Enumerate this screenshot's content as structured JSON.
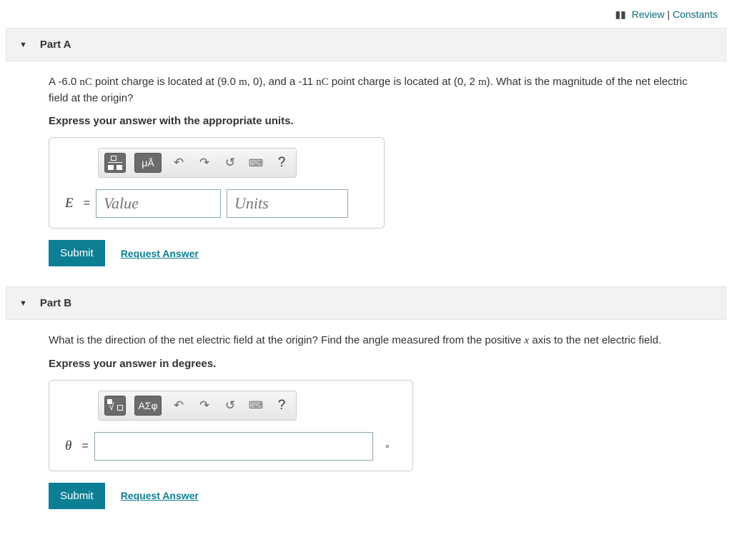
{
  "topnav": {
    "review": "Review",
    "constants": "Constants",
    "separator": " | "
  },
  "partA": {
    "title": "Part A",
    "question_html": "A -6.0 <span class='rm'>nC</span> point charge is located at (9.0 <span class='rm'>m</span>, 0), and a -11 <span class='rm'>nC</span> point charge is located at (0, 2 <span class='rm'>m</span>). What is the magnitude of the net electric field at the origin?",
    "instruction": "Express your answer with the appropriate units.",
    "toolbar": {
      "units_btn": "μÅ",
      "help": "?"
    },
    "var_label": "E",
    "value_placeholder": "Value",
    "units_placeholder": "Units",
    "submit": "Submit",
    "request": "Request Answer"
  },
  "partB": {
    "title": "Part B",
    "question_html": "What is the direction of the net electric field at the origin? Find the angle measured from the positive <span class='math-var'>x</span> axis to the net electric field.",
    "instruction": "Express your answer in degrees.",
    "toolbar": {
      "greek_btn": "ΑΣφ",
      "help": "?"
    },
    "var_label": "θ",
    "unit_suffix": "∘",
    "submit": "Submit",
    "request": "Request Answer"
  }
}
